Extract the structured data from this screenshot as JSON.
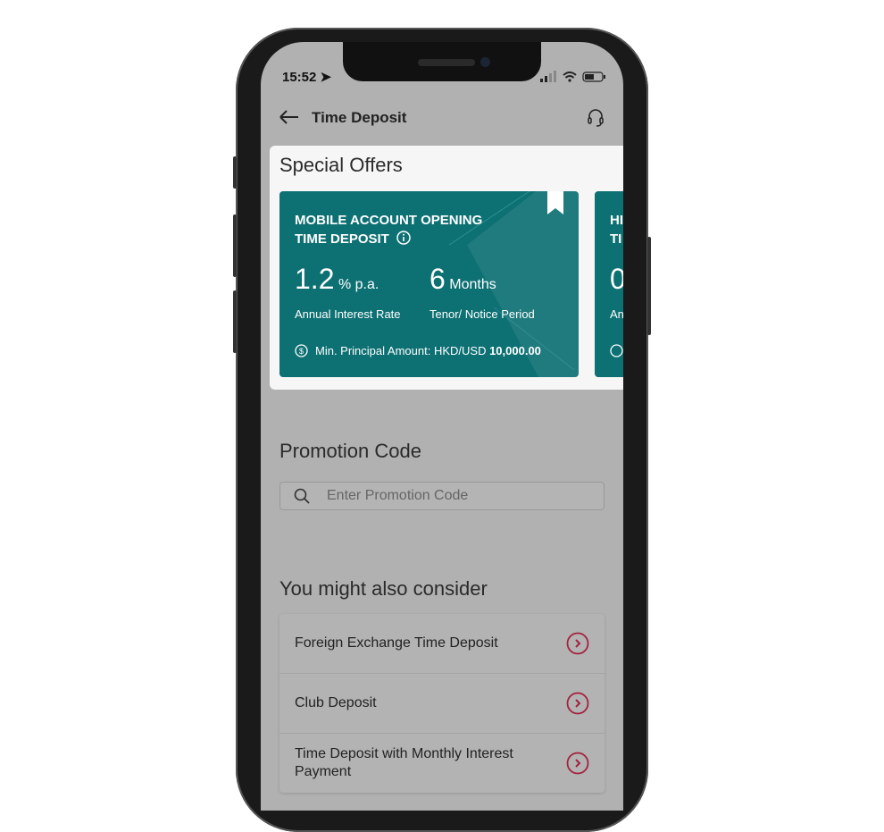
{
  "status_bar": {
    "time": "15:52"
  },
  "header": {
    "title": "Time Deposit"
  },
  "special_offers": {
    "heading": "Special Offers",
    "cards": [
      {
        "title_line1": "MOBILE ACCOUNT OPENING",
        "title_line2": "TIME DEPOSIT",
        "rate": "1.2",
        "rate_unit": "% p.a.",
        "rate_label": "Annual Interest Rate",
        "tenor": "6",
        "tenor_unit": "Months",
        "tenor_label": "Tenor/ Notice Period",
        "min_label": "Min. Principal Amount: HKD/USD ",
        "min_value": "10,000.00"
      },
      {
        "title_line1": "HI",
        "title_line2": "TI",
        "rate": "0",
        "rate_label": "An"
      }
    ]
  },
  "promotion": {
    "heading": "Promotion Code",
    "placeholder": "Enter Promotion Code"
  },
  "consider": {
    "heading": "You might also consider",
    "items": [
      {
        "label": "Foreign Exchange Time Deposit"
      },
      {
        "label": "Club Deposit"
      },
      {
        "label": "Time Deposit with Monthly Interest Payment"
      }
    ]
  },
  "colors": {
    "card": "#0d7073",
    "accent": "#a3223f"
  }
}
